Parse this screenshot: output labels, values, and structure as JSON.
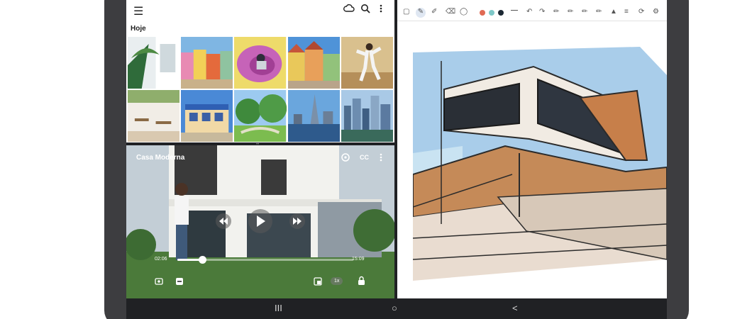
{
  "gallery": {
    "date_label": "Hoje",
    "toolbar_icons": [
      "menu-icon",
      "cloud-icon",
      "search-icon",
      "more-vert-icon"
    ],
    "thumbnails": [
      {
        "name": "thumb-palm-building"
      },
      {
        "name": "thumb-colorful-street"
      },
      {
        "name": "thumb-pink-skater"
      },
      {
        "name": "thumb-town-square"
      },
      {
        "name": "thumb-dancer"
      },
      {
        "name": "thumb-cafe-patio"
      },
      {
        "name": "thumb-blue-storefront"
      },
      {
        "name": "thumb-park-trees"
      },
      {
        "name": "thumb-city-skyline"
      },
      {
        "name": "thumb-city-river"
      }
    ]
  },
  "video": {
    "title": "Casa Moderna",
    "cc_label": "CC",
    "time_current": "02:06",
    "time_total": "15:09",
    "progress": 0.14,
    "speed_label": "1x"
  },
  "notes": {
    "colors": [
      "#e06a54",
      "#7ec8c8",
      "#1c2833"
    ]
  },
  "nav": {
    "recents": "III",
    "home": "○",
    "back": "<"
  }
}
